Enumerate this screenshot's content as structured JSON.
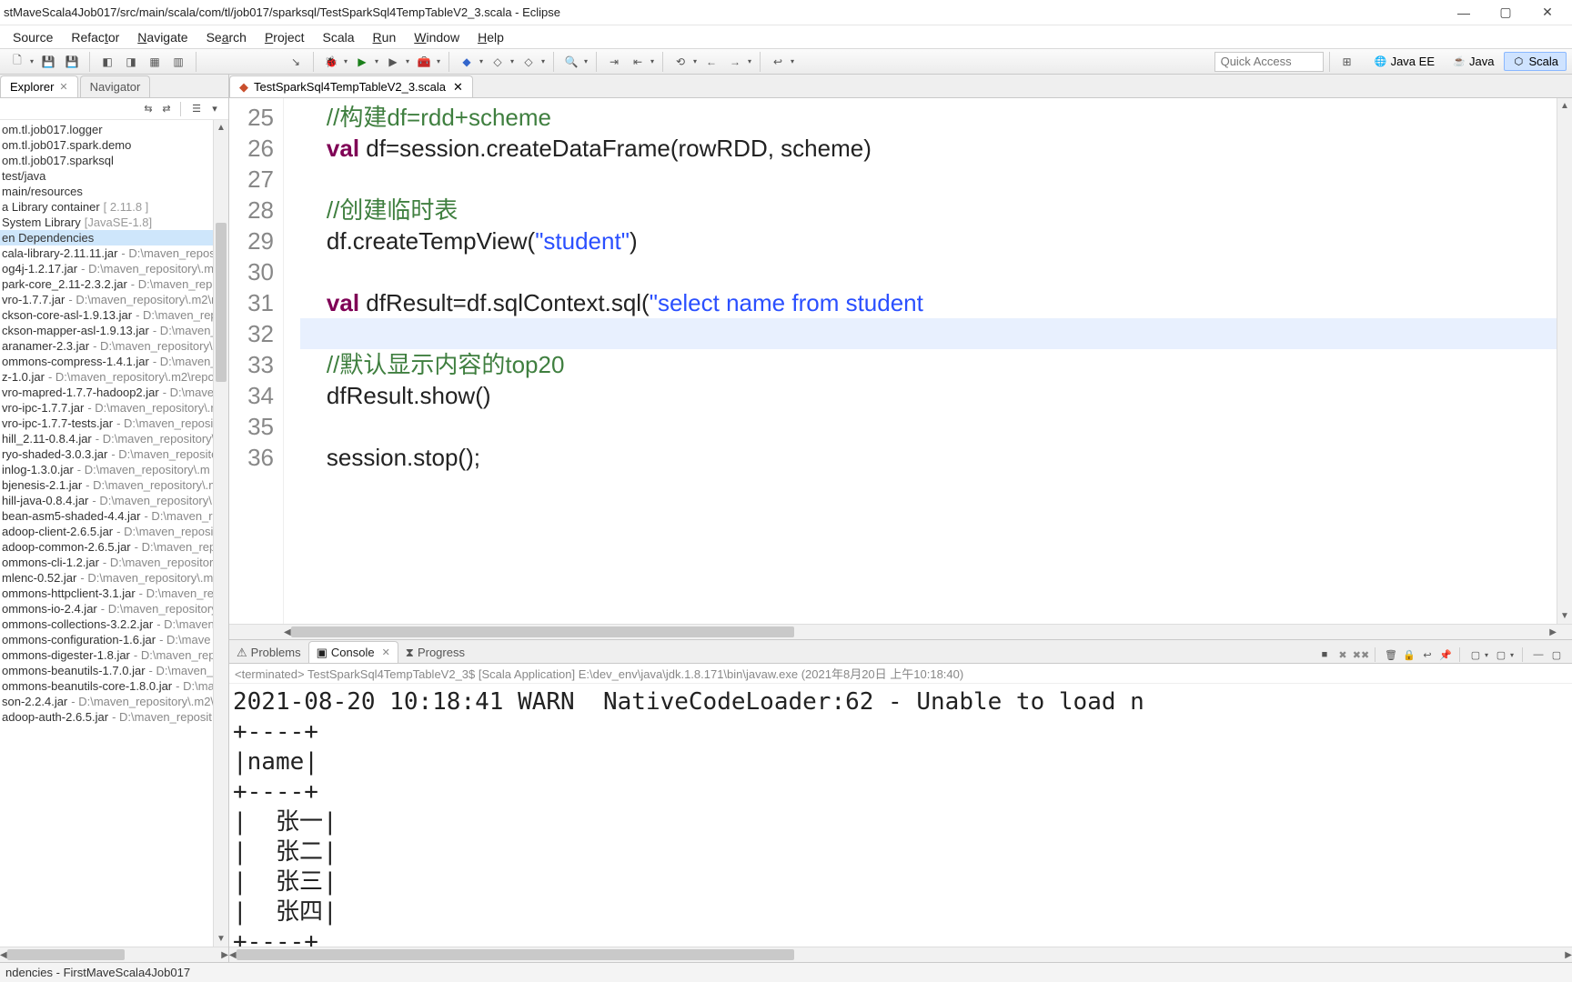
{
  "title": "stMaveScala4Job017/src/main/scala/com/tl/job017/sparksql/TestSparkSql4TempTableV2_3.scala - Eclipse",
  "menus": [
    "Source",
    "Refactor",
    "Navigate",
    "Search",
    "Project",
    "Scala",
    "Run",
    "Window",
    "Help"
  ],
  "quick_access": "Quick Access",
  "perspectives": [
    {
      "label": "Java EE"
    },
    {
      "label": "Java"
    },
    {
      "label": "Scala"
    }
  ],
  "left_tabs": {
    "explorer": "Explorer",
    "navigator": "Navigator"
  },
  "tree_top": [
    "om.tl.job017.logger",
    "om.tl.job017.spark.demo",
    "om.tl.job017.sparksql",
    "test/java",
    "main/resources"
  ],
  "tree_lib1": {
    "text": "a Library container",
    "hint": " [ 2.11.8 ]"
  },
  "tree_lib2": {
    "text": "System Library ",
    "hint": "[JavaSE-1.8]"
  },
  "tree_sel": "en Dependencies",
  "jars": [
    {
      "n": "cala-library-2.11.11.jar",
      "p": " - D:\\maven_reposi"
    },
    {
      "n": "og4j-1.2.17.jar",
      "p": " - D:\\maven_repository\\.m2"
    },
    {
      "n": "park-core_2.11-2.3.2.jar",
      "p": " - D:\\maven_repo"
    },
    {
      "n": "vro-1.7.7.jar",
      "p": " - D:\\maven_repository\\.m2\\r"
    },
    {
      "n": "ckson-core-asl-1.9.13.jar",
      "p": " - D:\\maven_rep"
    },
    {
      "n": "ckson-mapper-asl-1.9.13.jar",
      "p": " - D:\\maven_"
    },
    {
      "n": "aranamer-2.3.jar",
      "p": " - D:\\maven_repository\\."
    },
    {
      "n": "ommons-compress-1.4.1.jar",
      "p": " - D:\\maven_re"
    },
    {
      "n": "z-1.0.jar",
      "p": " - D:\\maven_repository\\.m2\\repo"
    },
    {
      "n": "vro-mapred-1.7.7-hadoop2.jar",
      "p": " - D:\\mave"
    },
    {
      "n": "vro-ipc-1.7.7.jar",
      "p": " - D:\\maven_repository\\.r"
    },
    {
      "n": "vro-ipc-1.7.7-tests.jar",
      "p": " - D:\\maven_reposit"
    },
    {
      "n": "hill_2.11-0.8.4.jar",
      "p": " - D:\\maven_repository\\"
    },
    {
      "n": "ryo-shaded-3.0.3.jar",
      "p": " - D:\\maven_reposito"
    },
    {
      "n": "inlog-1.3.0.jar",
      "p": " - D:\\maven_repository\\.m"
    },
    {
      "n": "bjenesis-2.1.jar",
      "p": " - D:\\maven_repository\\.m"
    },
    {
      "n": "hill-java-0.8.4.jar",
      "p": " - D:\\maven_repository\\.r"
    },
    {
      "n": "bean-asm5-shaded-4.4.jar",
      "p": " - D:\\maven_re"
    },
    {
      "n": "adoop-client-2.6.5.jar",
      "p": " - D:\\maven_reposit"
    },
    {
      "n": "adoop-common-2.6.5.jar",
      "p": " - D:\\maven_rep"
    },
    {
      "n": "ommons-cli-1.2.jar",
      "p": " - D:\\maven_repositor"
    },
    {
      "n": "mlenc-0.52.jar",
      "p": " - D:\\maven_repository\\.m2"
    },
    {
      "n": "ommons-httpclient-3.1.jar",
      "p": " - D:\\maven_re"
    },
    {
      "n": "ommons-io-2.4.jar",
      "p": " - D:\\maven_repository"
    },
    {
      "n": "ommons-collections-3.2.2.jar",
      "p": " - D:\\maven"
    },
    {
      "n": "ommons-configuration-1.6.jar",
      "p": " - D:\\mave"
    },
    {
      "n": "ommons-digester-1.8.jar",
      "p": " - D:\\maven_rep"
    },
    {
      "n": "ommons-beanutils-1.7.0.jar",
      "p": " - D:\\maven_r"
    },
    {
      "n": "ommons-beanutils-core-1.8.0.jar",
      "p": " - D:\\ma"
    },
    {
      "n": "son-2.2.4.jar",
      "p": " - D:\\maven_repository\\.m2\\"
    },
    {
      "n": "adoop-auth-2.6.5.jar",
      "p": " - D:\\maven_reposit"
    }
  ],
  "editor_tab": "TestSparkSql4TempTableV2_3.scala",
  "line_start": 25,
  "code_lines": [
    {
      "t": "comment",
      "s": "    //构建df=rdd+scheme"
    },
    {
      "t": "code",
      "s": "    <kw>val</kw> df=session.createDataFrame(rowRDD, scheme)"
    },
    {
      "t": "blank",
      "s": ""
    },
    {
      "t": "comment",
      "s": "    //创建临时表"
    },
    {
      "t": "code",
      "s": "    df.createTempView(<str>\"student\"</str>)"
    },
    {
      "t": "blank",
      "s": ""
    },
    {
      "t": "code",
      "s": "    <kw>val</kw> dfResult=df.sqlContext.sql(<str>\"select name from student</str>"
    },
    {
      "t": "blank",
      "s": "",
      "current": true
    },
    {
      "t": "comment",
      "s": "    //默认显示内容的top20"
    },
    {
      "t": "code",
      "s": "    dfResult.show()"
    },
    {
      "t": "blank",
      "s": ""
    },
    {
      "t": "code",
      "s": "    session.stop();"
    }
  ],
  "bottom_tabs": {
    "problems": "Problems",
    "console": "Console",
    "progress": "Progress"
  },
  "console_header": "<terminated> TestSparkSql4TempTableV2_3$ [Scala Application] E:\\dev_env\\java\\jdk.1.8.171\\bin\\javaw.exe (2021年8月20日 上午10:18:40)",
  "console_lines": [
    "2021-08-20 10:18:41 WARN  NativeCodeLoader:62 - Unable to load n",
    "+----+",
    "|name|",
    "+----+",
    "|  张一|",
    "|  张二|",
    "|  张三|",
    "|  张四|",
    "+----+"
  ],
  "status": "ndencies - FirstMaveScala4Job017"
}
